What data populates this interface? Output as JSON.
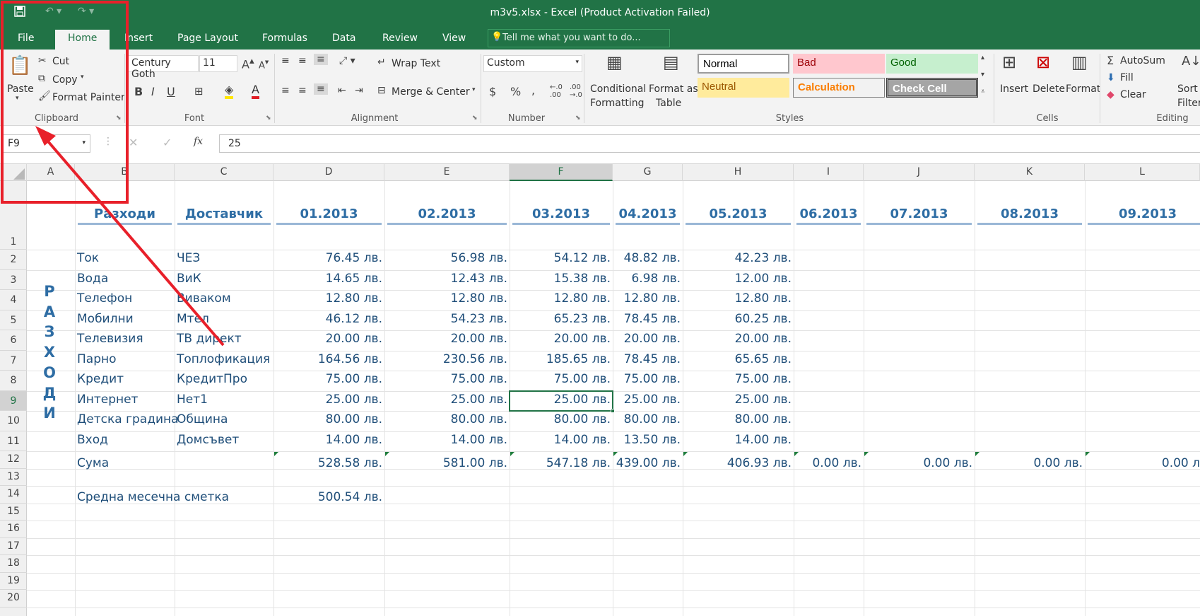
{
  "window": {
    "title": "m3v5.xlsx - Excel (Product Activation Failed)"
  },
  "qat": {
    "save_icon": "save-icon",
    "undo_icon": "undo-icon",
    "redo_icon": "redo-icon"
  },
  "tabs": [
    "File",
    "Home",
    "Insert",
    "Page Layout",
    "Formulas",
    "Data",
    "Review",
    "View"
  ],
  "tell_me": "Tell me what you want to do...",
  "ribbon": {
    "clipboard": {
      "paste": "Paste",
      "cut": "Cut",
      "copy": "Copy",
      "format_painter": "Format Painter",
      "label": "Clipboard"
    },
    "font": {
      "name": "Century Goth",
      "size": "11",
      "label": "Font",
      "bold": "B",
      "italic": "I",
      "underline": "U"
    },
    "alignment": {
      "wrap": "Wrap Text",
      "merge": "Merge & Center",
      "label": "Alignment"
    },
    "number": {
      "format": "Custom",
      "currency": "$",
      "percent": "%",
      "comma": ",",
      "label": "Number"
    },
    "styles": {
      "conditional": "Conditional",
      "conditional2": "Formatting",
      "format_table": "Format as",
      "format_table2": "Table",
      "normal": "Normal",
      "bad": "Bad",
      "good": "Good",
      "neutral": "Neutral",
      "calculation": "Calculation",
      "check_cell": "Check Cell",
      "label": "Styles"
    },
    "cells": {
      "insert": "Insert",
      "delete": "Delete",
      "format": "Format",
      "label": "Cells"
    },
    "editing": {
      "autosum": "AutoSum",
      "fill": "Fill",
      "clear": "Clear",
      "sort": "Sort &",
      "filter": "Filter",
      "label": "Editing"
    }
  },
  "formula_bar": {
    "name_box": "F9",
    "fx": "fx",
    "value": "25"
  },
  "columns": [
    "A",
    "B",
    "C",
    "D",
    "E",
    "F",
    "G",
    "H",
    "I",
    "J",
    "K",
    "L"
  ],
  "rows": [
    "1",
    "2",
    "3",
    "4",
    "5",
    "6",
    "7",
    "8",
    "9",
    "10",
    "11",
    "12",
    "13",
    "14",
    "15",
    "16",
    "17",
    "18",
    "19",
    "20"
  ],
  "sheet": {
    "headers": {
      "b": "Разходи",
      "c": "Доставчик",
      "d": "01.2013",
      "e": "02.2013",
      "f": "03.2013",
      "g": "04.2013",
      "h": "05.2013",
      "i": "06.2013",
      "j": "07.2013",
      "k": "08.2013",
      "l": "09.2013"
    },
    "vertical_label": [
      "Р",
      "А",
      "З",
      "Х",
      "О",
      "Д",
      "И"
    ],
    "data_rows": [
      {
        "b": "Ток",
        "c": "ЧЕЗ",
        "d": "76.45 лв.",
        "e": "56.98 лв.",
        "f": "54.12 лв.",
        "g": "48.82 лв.",
        "h": "42.23 лв."
      },
      {
        "b": "Вода",
        "c": "ВиК",
        "d": "14.65 лв.",
        "e": "12.43 лв.",
        "f": "15.38 лв.",
        "g": "6.98 лв.",
        "h": "12.00 лв."
      },
      {
        "b": "Телефон",
        "c": "Виваком",
        "d": "12.80 лв.",
        "e": "12.80 лв.",
        "f": "12.80 лв.",
        "g": "12.80 лв.",
        "h": "12.80 лв."
      },
      {
        "b": "Мобилни",
        "c": "Мтел",
        "d": "46.12 лв.",
        "e": "54.23 лв.",
        "f": "65.23 лв.",
        "g": "78.45 лв.",
        "h": "60.25 лв."
      },
      {
        "b": "Телевизия",
        "c": "ТВ директ",
        "d": "20.00 лв.",
        "e": "20.00 лв.",
        "f": "20.00 лв.",
        "g": "20.00 лв.",
        "h": "20.00 лв."
      },
      {
        "b": "Парно",
        "c": "Топлофикация",
        "d": "164.56 лв.",
        "e": "230.56 лв.",
        "f": "185.65 лв.",
        "g": "78.45 лв.",
        "h": "65.65 лв."
      },
      {
        "b": "Кредит",
        "c": "КредитПро",
        "d": "75.00 лв.",
        "e": "75.00 лв.",
        "f": "75.00 лв.",
        "g": "75.00 лв.",
        "h": "75.00 лв."
      },
      {
        "b": "Интернет",
        "c": "Нет1",
        "d": "25.00 лв.",
        "e": "25.00 лв.",
        "f": "25.00 лв.",
        "g": "25.00 лв.",
        "h": "25.00 лв."
      },
      {
        "b": "Детска градина",
        "c": "Община",
        "d": "80.00 лв.",
        "e": "80.00 лв.",
        "f": "80.00 лв.",
        "g": "80.00 лв.",
        "h": "80.00 лв."
      },
      {
        "b": "Вход",
        "c": "Домсъвет",
        "d": "14.00 лв.",
        "e": "14.00 лв.",
        "f": "14.00 лв.",
        "g": "13.50 лв.",
        "h": "14.00 лв."
      }
    ],
    "sum_row": {
      "b": "Сума",
      "d": "528.58 лв.",
      "e": "581.00 лв.",
      "f": "547.18 лв.",
      "g": "439.00 лв.",
      "h": "406.93 лв.",
      "i": "0.00 лв.",
      "j": "0.00 лв.",
      "k": "0.00 лв.",
      "l": "0.00 л"
    },
    "avg_row": {
      "b": "Средна месечна сметка",
      "d": "500.54 лв."
    }
  },
  "colors": {
    "accent": "#217346",
    "highlight": "#e8202a"
  }
}
